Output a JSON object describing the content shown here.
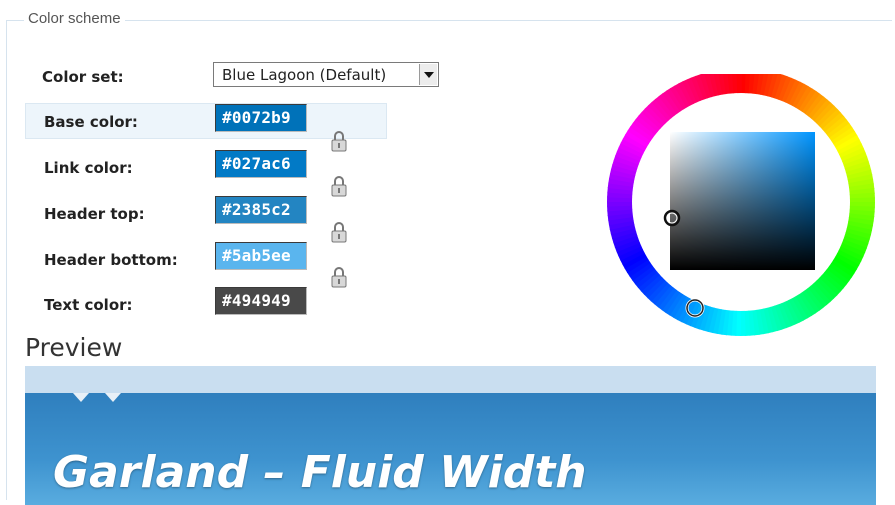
{
  "fieldset": {
    "legend": "Color scheme"
  },
  "color_set": {
    "label": "Color set:",
    "selected": "Blue Lagoon (Default)"
  },
  "fields": [
    {
      "label": "Base color:",
      "value": "#0072b9",
      "bg": "#0072b9"
    },
    {
      "label": "Link color:",
      "value": "#027ac6",
      "bg": "#027ac6"
    },
    {
      "label": "Header top:",
      "value": "#2385c2",
      "bg": "#2385c2"
    },
    {
      "label": "Header bottom:",
      "value": "#5ab5ee",
      "bg": "#5ab5ee"
    },
    {
      "label": "Text color:",
      "value": "#494949",
      "bg": "#494949"
    }
  ],
  "preview": {
    "title": "Preview",
    "site_name": "Garland  –  Fluid Width",
    "header_top_color": "#2385c2",
    "header_bottom_color": "#5ab5ee"
  },
  "icons": {
    "lock": "lock-icon",
    "select_arrow": "chevron-down-icon"
  }
}
